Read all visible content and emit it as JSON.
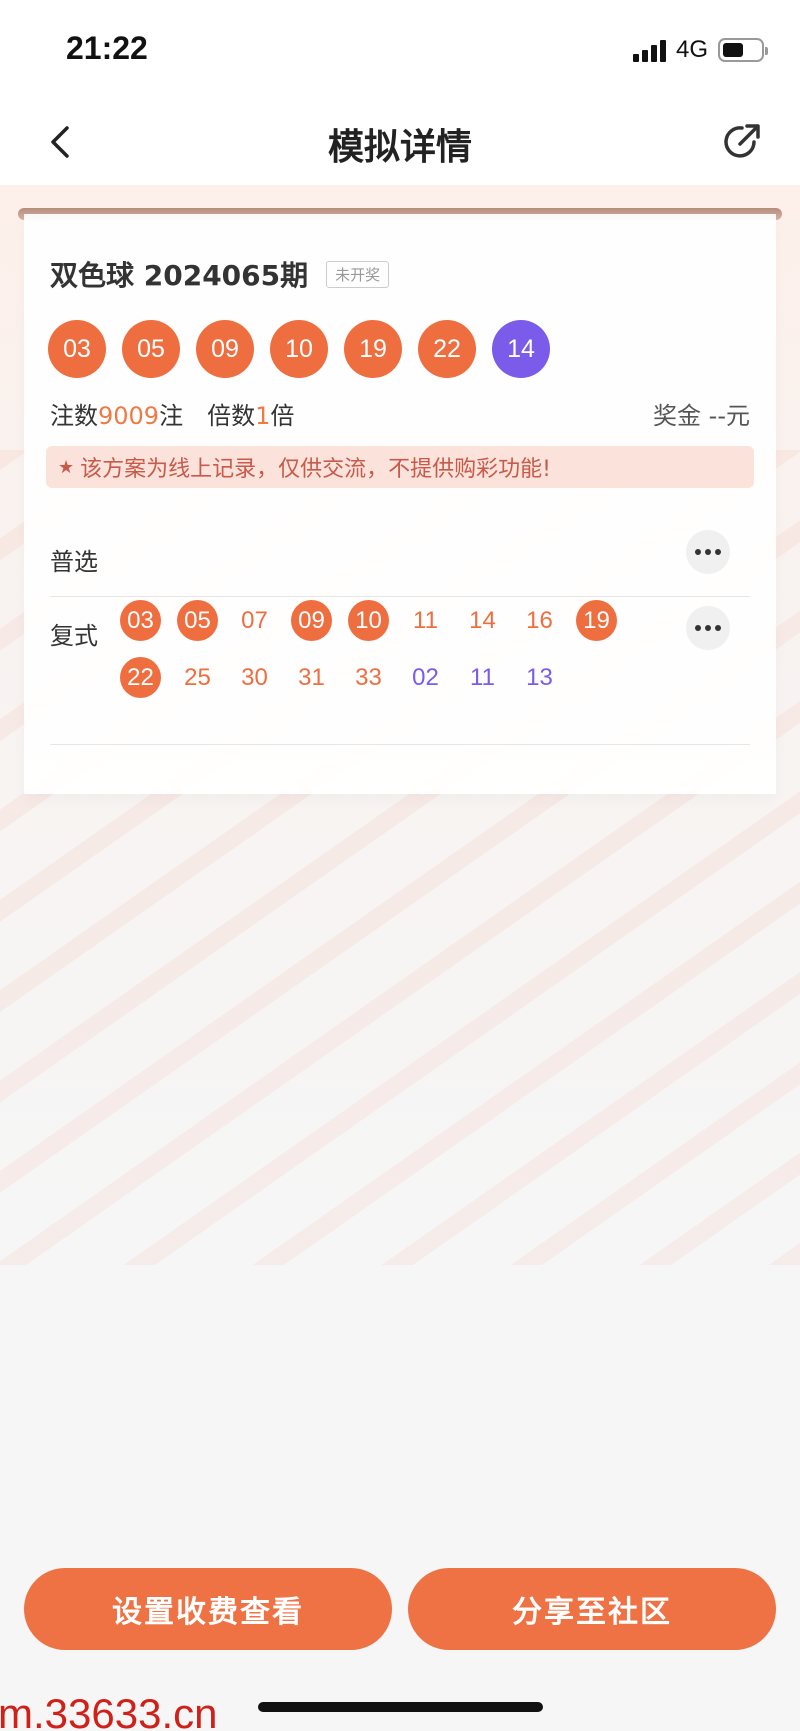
{
  "status_bar": {
    "time": "21:22",
    "network": "4G"
  },
  "nav": {
    "title": "模拟详情"
  },
  "ticket": {
    "lottery": "双色球 2024065期",
    "status_badge": "未开奖",
    "result_balls": [
      {
        "n": "03",
        "c": "red"
      },
      {
        "n": "05",
        "c": "red"
      },
      {
        "n": "09",
        "c": "red"
      },
      {
        "n": "10",
        "c": "red"
      },
      {
        "n": "19",
        "c": "red"
      },
      {
        "n": "22",
        "c": "red"
      },
      {
        "n": "14",
        "c": "blue"
      }
    ],
    "bets_label": "注数",
    "bets_value": "9009",
    "bets_unit": "注",
    "multiple_label": "倍数",
    "multiple_value": "1",
    "multiple_unit": "倍",
    "prize": "奖金 --元",
    "notice": "该方案为线上记录，仅供交流，不提供购彩功能!",
    "notice_icon": "star-icon",
    "section_pick": "普选",
    "compound_label": "复式",
    "compound_numbers": [
      {
        "n": "03",
        "t": "hit"
      },
      {
        "n": "05",
        "t": "hit"
      },
      {
        "n": "07",
        "t": "red"
      },
      {
        "n": "09",
        "t": "hit"
      },
      {
        "n": "10",
        "t": "hit"
      },
      {
        "n": "11",
        "t": "red"
      },
      {
        "n": "14",
        "t": "red"
      },
      {
        "n": "16",
        "t": "red"
      },
      {
        "n": "19",
        "t": "hit"
      },
      {
        "n": "22",
        "t": "hit"
      },
      {
        "n": "25",
        "t": "red"
      },
      {
        "n": "30",
        "t": "red"
      },
      {
        "n": "31",
        "t": "red"
      },
      {
        "n": "33",
        "t": "red"
      },
      {
        "n": "02",
        "t": "blue"
      },
      {
        "n": "11",
        "t": "blue"
      },
      {
        "n": "13",
        "t": "blue"
      }
    ]
  },
  "buttons": {
    "set_fee": "设置收费查看",
    "share": "分享至社区"
  },
  "site_watermark": "m.33633.cn",
  "colors": {
    "accent": "#ee7244",
    "red_ball": "#ee6e40",
    "blue_ball": "#7a5bea"
  }
}
